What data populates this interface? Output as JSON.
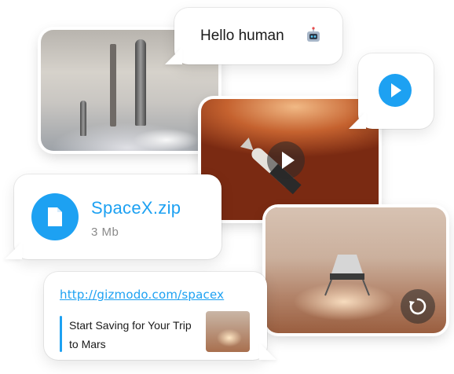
{
  "chat": {
    "hello_message": "Hello human",
    "hello_emoji": "robot-face",
    "file": {
      "name": "SpaceX.zip",
      "size": "3 Mb"
    },
    "link": {
      "url": "http://gizmodo.com/spacex",
      "title": "Start Saving for Your Trip to Mars"
    },
    "media": [
      {
        "kind": "image",
        "subject": "launch-pad"
      },
      {
        "kind": "video",
        "subject": "mars-orbit"
      },
      {
        "kind": "video",
        "subject": "mars-landing"
      }
    ]
  },
  "colors": {
    "accent": "#1da1f2",
    "text": "#1a1a1a",
    "muted": "#8a8a8a"
  }
}
